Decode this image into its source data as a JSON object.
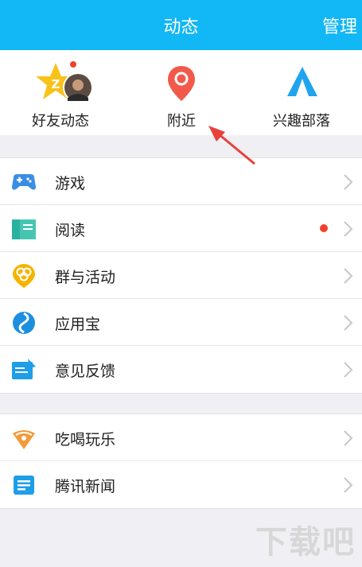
{
  "header": {
    "title": "动态",
    "manage_label": "管理"
  },
  "quick": [
    {
      "label": "好友动态",
      "icon": "friend-feed-icon",
      "badge": true
    },
    {
      "label": "附近",
      "icon": "location-pin-icon",
      "badge": false
    },
    {
      "label": "兴趣部落",
      "icon": "tent-icon",
      "badge": false
    }
  ],
  "list1": [
    {
      "label": "游戏",
      "icon": "gamepad-icon",
      "color": "#3a8ee6",
      "dot": false
    },
    {
      "label": "阅读",
      "icon": "book-icon",
      "color": "#2ab2a0",
      "dot": true
    },
    {
      "label": "群与活动",
      "icon": "group-activity-icon",
      "color": "#f5b400",
      "dot": false
    },
    {
      "label": "应用宝",
      "icon": "app-store-icon",
      "color": "#1d8fe0",
      "dot": false
    },
    {
      "label": "意见反馈",
      "icon": "feedback-icon",
      "color": "#1e9ee8",
      "dot": false
    }
  ],
  "list2": [
    {
      "label": "吃喝玩乐",
      "icon": "food-fun-icon",
      "color": "#f39a3a",
      "dot": false
    },
    {
      "label": "腾讯新闻",
      "icon": "news-icon",
      "color": "#1e9ee8",
      "dot": false
    }
  ],
  "watermark": "下载吧",
  "colors": {
    "header": "#12b7f5",
    "badge": "#f0412c",
    "accent": "#f15a4a"
  }
}
